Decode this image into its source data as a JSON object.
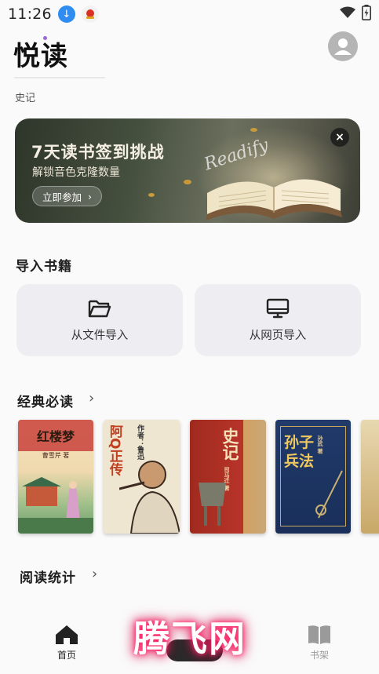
{
  "status_bar": {
    "time": "11:26",
    "icons": [
      "download-icon",
      "app-notification-icon",
      "wifi-icon",
      "battery-icon"
    ]
  },
  "header": {
    "app_title": "悦读",
    "last_read": "史记"
  },
  "banner": {
    "title": "7天读书签到挑战",
    "subtitle": "解锁音色克隆数量",
    "button_label": "立即参加",
    "script_text": "Readify",
    "close_icon": "×"
  },
  "import_section": {
    "title": "导入书籍",
    "cards": [
      {
        "label": "从文件导入",
        "icon": "folder-icon"
      },
      {
        "label": "从网页导入",
        "icon": "monitor-icon"
      }
    ]
  },
  "classics_section": {
    "title": "经典必读",
    "books": [
      {
        "title": "红楼梦",
        "author": "曹雪芹 著"
      },
      {
        "title": "阿Q正传",
        "author": "作者：鲁迅"
      },
      {
        "title": "史记",
        "author": "司马迁 著"
      },
      {
        "title": "孙子兵法",
        "author": "孙武 著"
      }
    ]
  },
  "stats_section": {
    "title": "阅读统计"
  },
  "bottom_nav": {
    "items": [
      {
        "label": "首页",
        "icon": "home-icon",
        "active": true
      },
      {
        "label": "书架",
        "icon": "bookshelf-icon",
        "active": false
      }
    ]
  },
  "watermark": "腾飞网",
  "colors": {
    "background": "#fafafa",
    "card": "#eeeef2",
    "banner_dark": "#2e352a",
    "active_nav": "#222222",
    "inactive_nav": "#9a9a9a"
  }
}
